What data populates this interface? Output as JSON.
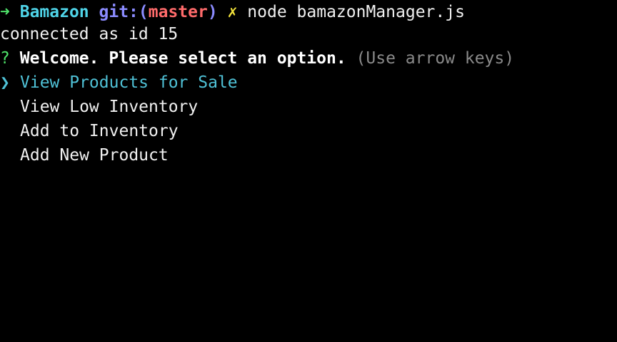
{
  "prompt": {
    "arrow": "➜",
    "directory": "Bamazon",
    "git_prefix": "git:(",
    "branch": "master",
    "git_suffix": ")",
    "dirty_marker": "✗",
    "command": "node bamazonManager.js"
  },
  "output": {
    "connection_line": "connected as id 15"
  },
  "question": {
    "mark": "?",
    "text": "Welcome. Please select an option.",
    "hint": "(Use arrow keys)"
  },
  "menu": {
    "pointer": "❯",
    "choices": [
      "View Products for Sale",
      "View Low Inventory",
      "Add to Inventory",
      "Add New Product"
    ],
    "selected_index": 0
  },
  "colors": {
    "background": "#000000",
    "prompt_arrow": "#4fe36a",
    "directory": "#4fd4e8",
    "git_label": "#8b8bff",
    "branch": "#ff6b6b",
    "dirty_marker": "#f2e23b",
    "selected_choice": "#4fc1d6",
    "hint": "#8a8a8a"
  }
}
